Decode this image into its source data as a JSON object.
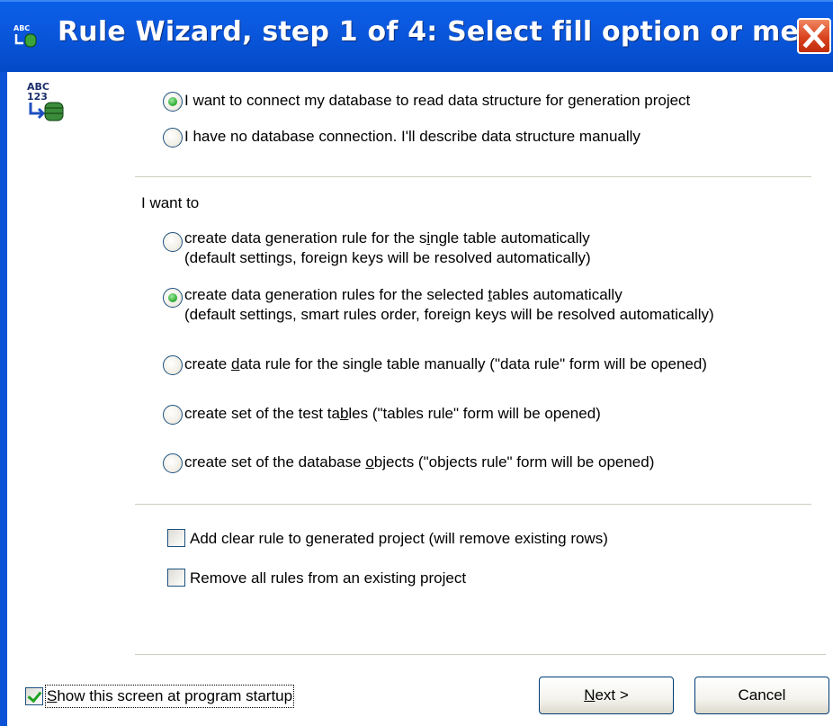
{
  "window": {
    "title": "Rule Wizard, step 1 of 4: Select fill option or me...",
    "title_icon": "wizard-database-icon",
    "close_icon": "close-x-icon"
  },
  "connection": {
    "options": [
      {
        "label": "I want to connect my database to read data structure for generation project",
        "selected": true
      },
      {
        "label": "I have no database connection. I'll describe data structure manually",
        "selected": false
      }
    ]
  },
  "actions": {
    "heading": "I want to",
    "opt1": {
      "line1_a": "create data generation rule for the s",
      "line1_u": "i",
      "line1_b": "ngle table automatically",
      "line2": "(default settings, foreign keys will be resolved automatically)",
      "selected": false
    },
    "opt2": {
      "line1_a": "create data generation rules for the selected ",
      "line1_u": "t",
      "line1_b": "ables automatically",
      "line2": "(default settings, smart rules order, foreign keys will be resolved automatically)",
      "selected": true
    },
    "opt3": {
      "a": "create ",
      "u": "d",
      "b": "ata rule for the single table manually (\"data rule\" form will be opened)",
      "selected": false
    },
    "opt4": {
      "a": "create set of the test ta",
      "u": "b",
      "b": "les (\"tables rule\" form will be opened)",
      "selected": false
    },
    "opt5": {
      "a": "create set of the database ",
      "u": "o",
      "b": "bjects (\"objects rule\" form will be opened)",
      "selected": false
    }
  },
  "options": {
    "add_clear_rule": {
      "label": "Add clear rule to generated project (will remove existing rows)",
      "checked": false
    },
    "remove_all_rules": {
      "label": "Remove all rules from an existing project",
      "checked": false
    }
  },
  "footer": {
    "show_startup": {
      "u": "S",
      "rest": "how this screen at program startup",
      "checked": true
    },
    "next_u": "N",
    "next_rest": "ext >",
    "cancel_label": "Cancel"
  },
  "colors": {
    "titlebar": "#0b58de",
    "radio_selected": "#2aa92d",
    "checkbox_check": "#21a121"
  }
}
